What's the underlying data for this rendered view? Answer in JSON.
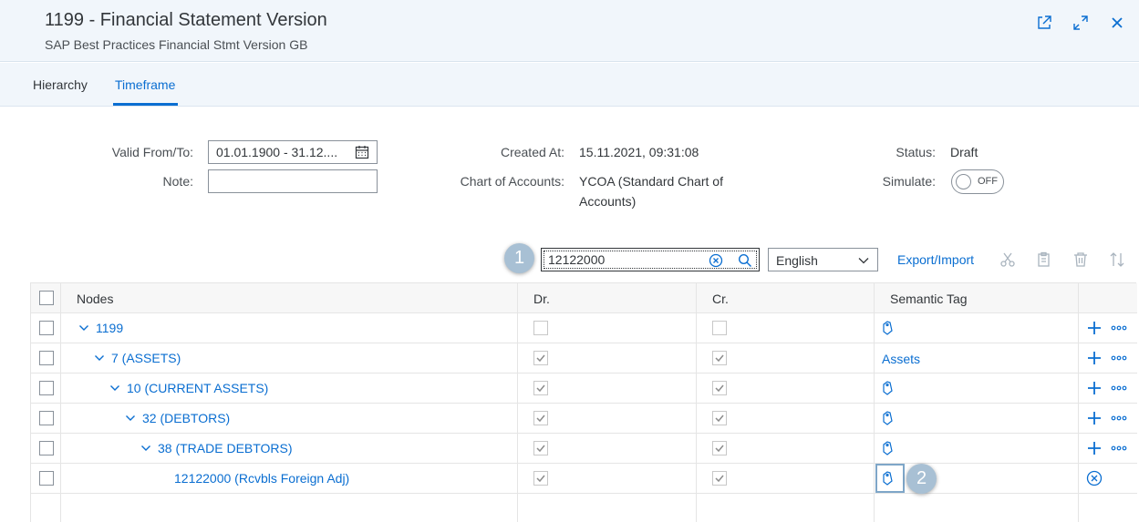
{
  "header": {
    "title": "1199 - Financial Statement Version",
    "subtitle": "SAP Best Practices Financial Stmt Version GB"
  },
  "tabs": [
    {
      "label": "Hierarchy",
      "selected": false
    },
    {
      "label": "Timeframe",
      "selected": true
    }
  ],
  "form": {
    "valid_label": "Valid From/To:",
    "valid_value": "01.01.1900 - 31.12....",
    "note_label": "Note:",
    "note_value": "",
    "created_label": "Created At:",
    "created_value": "15.11.2021, 09:31:08",
    "coa_label": "Chart of Accounts:",
    "coa_value_line1": "YCOA (Standard Chart of",
    "coa_value_line2": "Accounts)",
    "status_label": "Status:",
    "status_value": "Draft",
    "simulate_label": "Simulate:",
    "simulate_value": "OFF"
  },
  "toolbar": {
    "search_value": "12122000",
    "language": "English",
    "export_label": "Export/Import"
  },
  "callouts": {
    "one": "1",
    "two": "2"
  },
  "table": {
    "columns": [
      "Nodes",
      "Dr.",
      "Cr.",
      "Semantic Tag"
    ],
    "rows": [
      {
        "node": "1199",
        "dr": false,
        "cr": false,
        "tag": "",
        "action": "add"
      },
      {
        "node": "7 (ASSETS)",
        "dr": true,
        "cr": true,
        "tag": "Assets",
        "action": "add"
      },
      {
        "node": "10 (CURRENT ASSETS)",
        "dr": true,
        "cr": true,
        "tag": "",
        "action": "add"
      },
      {
        "node": "32 (DEBTORS)",
        "dr": true,
        "cr": true,
        "tag": "",
        "action": "add"
      },
      {
        "node": "38 (TRADE DEBTORS)",
        "dr": true,
        "cr": true,
        "tag": "",
        "action": "add"
      },
      {
        "node": "12122000 (Rcvbls Foreign Adj)",
        "dr": true,
        "cr": true,
        "tag": "",
        "action": "remove"
      }
    ]
  },
  "colors": {
    "accent": "#0a6ed1",
    "header_bg": "#f1f6fb",
    "callout": "#a8c0d4"
  }
}
